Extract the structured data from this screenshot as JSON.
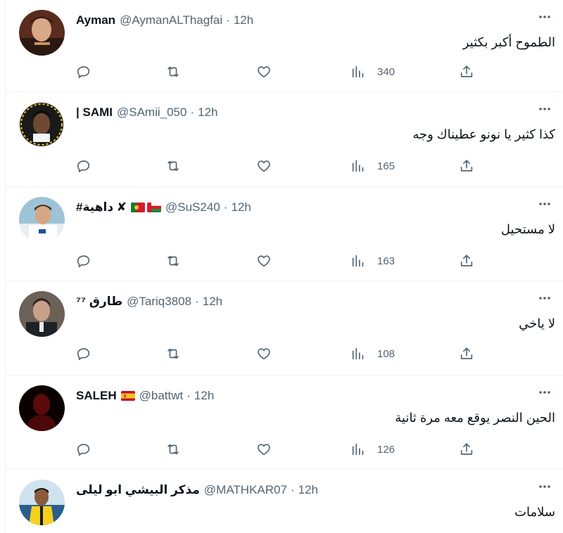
{
  "tweets": [
    {
      "name": "Ayman",
      "handle": "@AymanALThagfai",
      "dot": "·",
      "time": "12h",
      "text": "الطموح أكبر بكثير",
      "views": "340",
      "flags": []
    },
    {
      "name": "| SAMI",
      "handle": "@SAmii_050",
      "dot": "·",
      "time": "12h",
      "text": "كذا كثير يا نونو عطيناك وجه",
      "views": "165",
      "flags": []
    },
    {
      "name": "#داهية ✘",
      "handle": "@SuS240",
      "dot": "·",
      "time": "12h",
      "text": "لا  مستحيل",
      "views": "163",
      "flags": [
        "oman-flag",
        "portugal-flag"
      ]
    },
    {
      "name": "طارق ⁷⁷",
      "handle": "@Tariq3808",
      "dot": "·",
      "time": "12h",
      "text": "لا ياخي",
      "views": "108",
      "flags": []
    },
    {
      "name": "SALEH",
      "handle": "@battwt",
      "dot": "·",
      "time": "12h",
      "text": "الحين النصر يوقع معه مرة ثانية",
      "views": "126",
      "flags": [
        "spain-flag"
      ]
    },
    {
      "name": "مذكر البيشي ابو ليلى",
      "handle": "@MATHKAR07",
      "dot": "·",
      "time": "12h",
      "text": "سلامات",
      "views": "",
      "flags": []
    }
  ],
  "colors": {
    "secondary_text": "#536471",
    "primary_text": "#0f1419",
    "divider": "#eff3f4"
  },
  "icons": [
    "reply-icon",
    "retweet-icon",
    "like-icon",
    "views-icon",
    "share-icon",
    "more-icon"
  ]
}
